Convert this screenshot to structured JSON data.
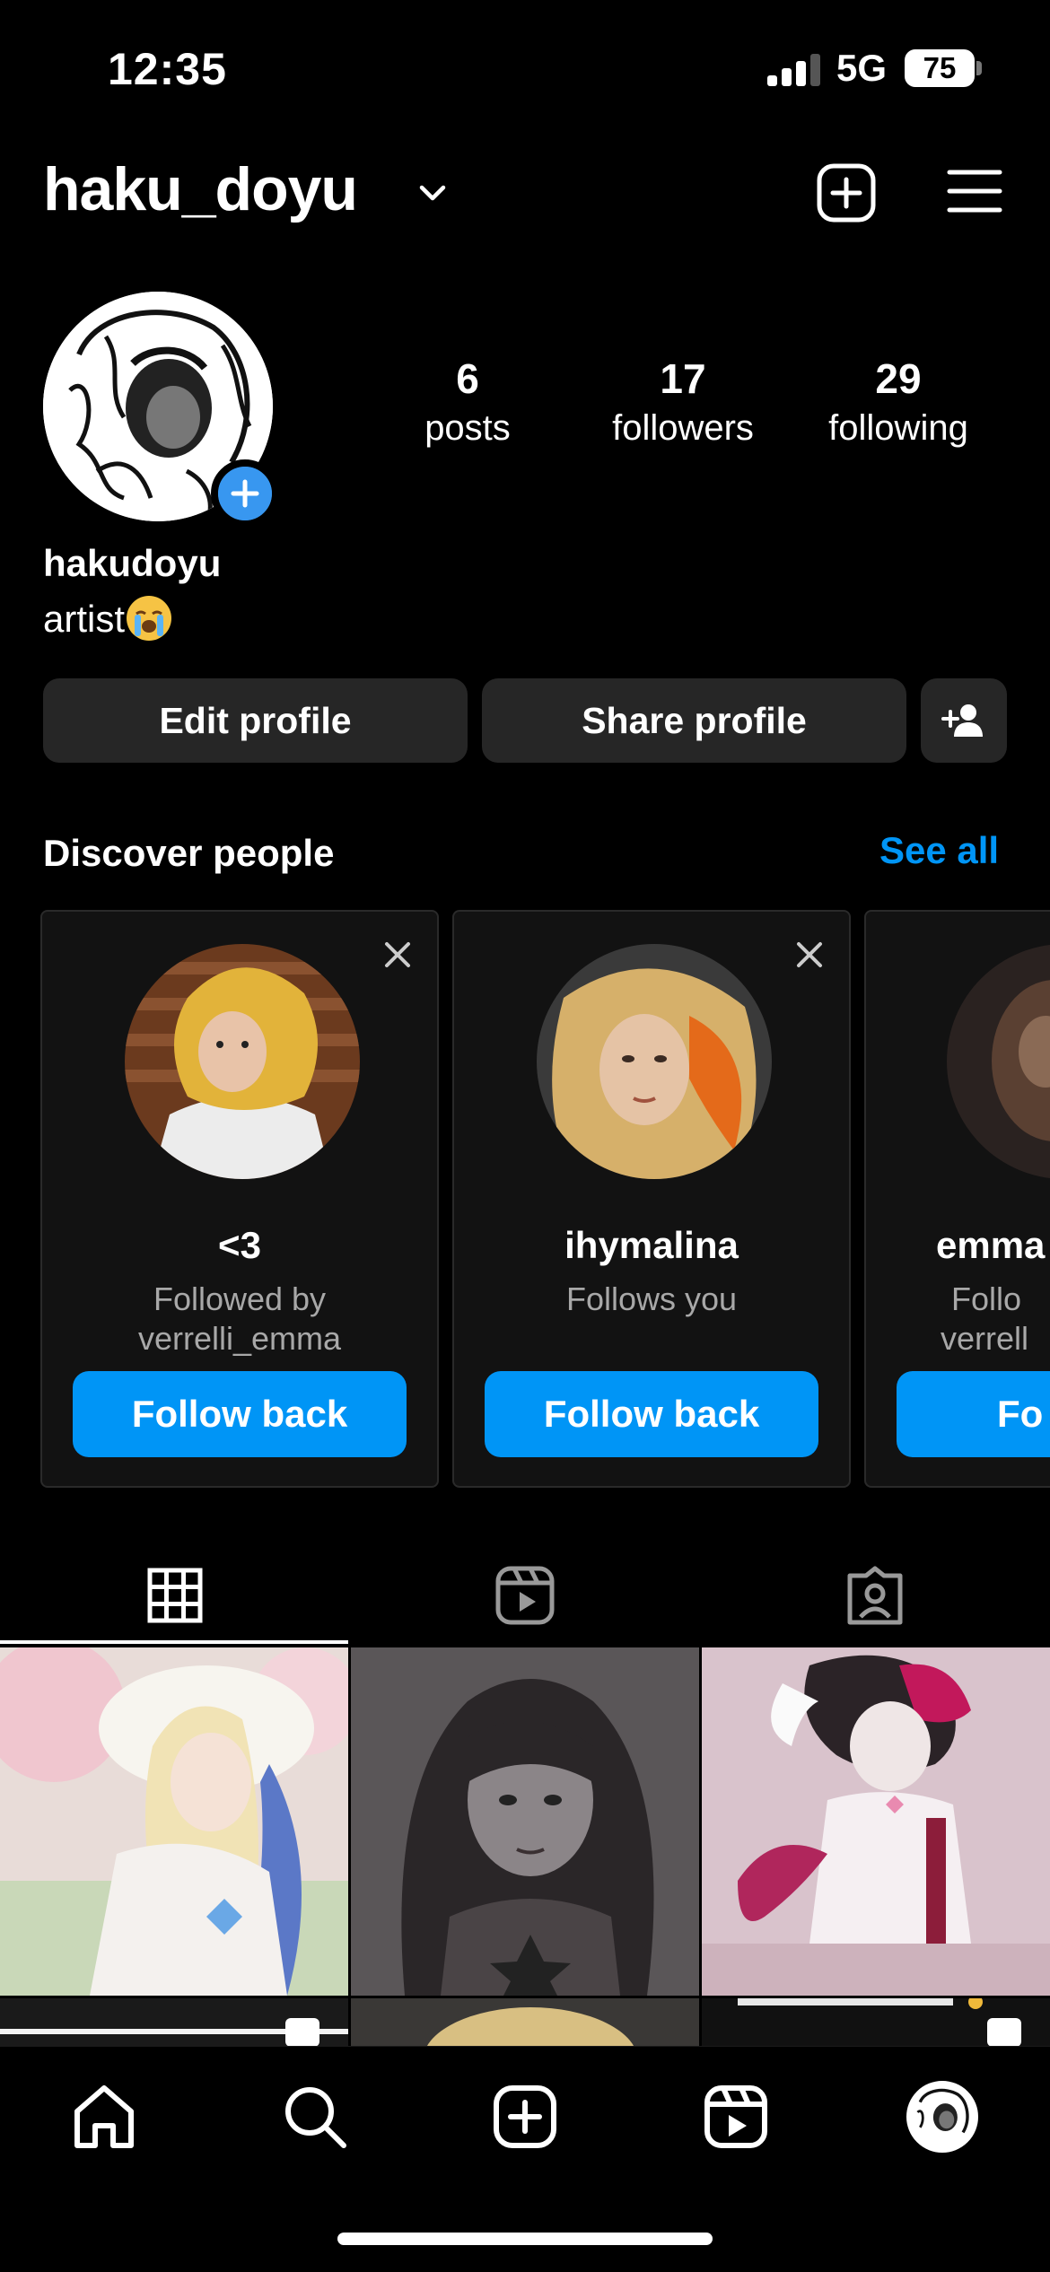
{
  "status_bar": {
    "time": "12:35",
    "network": "5G",
    "battery": "75"
  },
  "header": {
    "username": "haku_doyu"
  },
  "profile": {
    "stats": [
      {
        "value": "6",
        "label": "posts"
      },
      {
        "value": "17",
        "label": "followers"
      },
      {
        "value": "29",
        "label": "following"
      }
    ],
    "display_name": "hakudoyu",
    "bio": "artist",
    "bio_emoji": "loudly-crying-face-emoji"
  },
  "buttons": {
    "edit_profile": "Edit profile",
    "share_profile": "Share profile"
  },
  "discover": {
    "title": "Discover people",
    "see_all": "See all",
    "cards": [
      {
        "name": "<3",
        "subtitle_1": "Followed by",
        "subtitle_2": "verrelli_emma",
        "button": "Follow back"
      },
      {
        "name": "ihymalina",
        "subtitle_1": "Follows you",
        "subtitle_2": "",
        "button": "Follow back"
      },
      {
        "name": "emma",
        "subtitle_1": "Follo",
        "subtitle_2": "verrell",
        "button": "Fo"
      }
    ]
  },
  "colors": {
    "accent": "#0095f6",
    "button_dark": "#262626",
    "background": "#000000"
  },
  "icons": {
    "header": [
      "chevron-down-icon",
      "create-post-icon",
      "menu-icon"
    ],
    "tabs": [
      "grid-icon",
      "reels-icon",
      "tagged-icon"
    ],
    "nav": [
      "home-icon",
      "search-icon",
      "create-icon",
      "reels-icon",
      "profile-avatar"
    ]
  }
}
